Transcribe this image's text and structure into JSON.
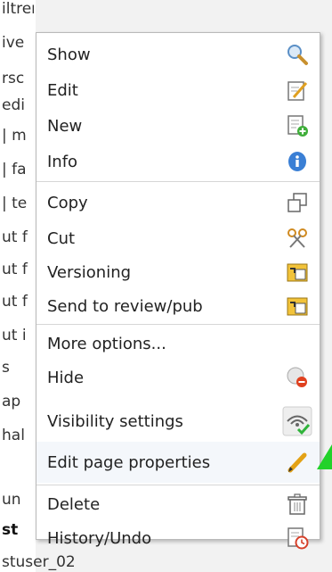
{
  "background": {
    "rows": [
      "iltren",
      "ive",
      "rsc",
      "edi",
      "| m",
      "| fa",
      "| te",
      "ut f",
      "ut f",
      "ut f",
      "ut i",
      "s",
      "ap",
      "hal",
      "",
      "un",
      "st"
    ],
    "bottom_text": "stuser_02"
  },
  "menu": {
    "items": [
      {
        "label": "Show",
        "icon": "magnifier-icon"
      },
      {
        "label": "Edit",
        "icon": "edit-page-icon"
      },
      {
        "label": "New",
        "icon": "new-page-icon"
      },
      {
        "label": "Info",
        "icon": "info-icon"
      },
      {
        "label": "Copy",
        "icon": "copy-icon"
      },
      {
        "label": "Cut",
        "icon": "scissors-icon"
      },
      {
        "label": "Versioning",
        "icon": "versioning-icon"
      },
      {
        "label": "Send to review/pub",
        "icon": "send-review-icon"
      },
      {
        "label": "More options...",
        "icon": ""
      },
      {
        "label": "Hide",
        "icon": "hide-icon"
      },
      {
        "label": "Visibility settings",
        "icon": "visibility-icon"
      },
      {
        "label": "Edit page properties",
        "icon": "pencil-icon"
      },
      {
        "label": "Delete",
        "icon": "trash-icon"
      },
      {
        "label": "History/Undo",
        "icon": "history-icon"
      }
    ]
  },
  "colors": {
    "accent_green": "#22d22a",
    "info_blue": "#3a7fd5",
    "hide_red": "#e0401e"
  }
}
